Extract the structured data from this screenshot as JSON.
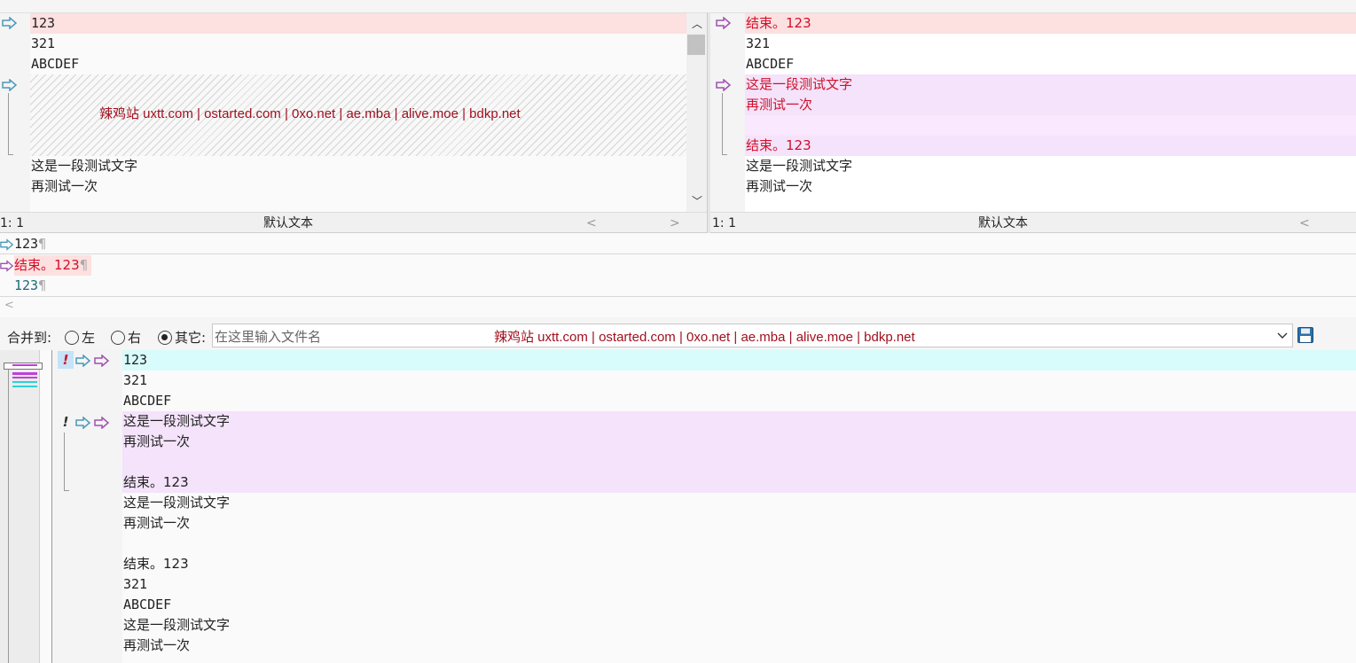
{
  "left_pane": {
    "lines": [
      "123",
      "321",
      "ABCDEF",
      "这是一段测试文字",
      "再测试一次"
    ],
    "watermark": "辣鸡站 uxtt.com | ostarted.com | 0xo.net | ae.mba | alive.moe | bdkp.net",
    "status": {
      "position": "1: 1",
      "encoding": "默认文本",
      "scroll_left": "<",
      "scroll_right": ">"
    }
  },
  "right_pane": {
    "lines": [
      "结束。123",
      "321",
      "ABCDEF",
      "这是一段测试文字",
      "再测试一次",
      "结束。123",
      "这是一段测试文字",
      "再测试一次"
    ],
    "status": {
      "position": "1: 1",
      "encoding": "默认文本",
      "scroll_left": "<"
    }
  },
  "detail_pane": {
    "lines": [
      "123",
      "结束。123",
      "123"
    ],
    "pilcrow": "¶",
    "scroll_left": "<"
  },
  "merge_bar": {
    "label": "合并到:",
    "options": [
      "左",
      "右",
      "其它:"
    ],
    "selected": "其它:",
    "filename_placeholder": "在这里输入文件名",
    "watermark": "辣鸡站 uxtt.com | ostarted.com | 0xo.net | ae.mba | alive.moe | bdkp.net"
  },
  "merge_pane": {
    "lines": [
      "123",
      "321",
      "ABCDEF",
      "这是一段测试文字",
      "再测试一次",
      "",
      "结束。123",
      "这是一段测试文字",
      "再测试一次",
      "",
      "结束。123",
      "321",
      "ABCDEF",
      "这是一段测试文字",
      "再测试一次"
    ],
    "conflict_marker": "!"
  },
  "colors": {
    "deleted_bg": "#fde0e0",
    "changed_bg": "#f4e3fa",
    "merged_bg": "#d8fbfb",
    "changed_text": "#d0102a",
    "arrow_left": "#4a9ab8",
    "arrow_right": "#a050b0"
  }
}
